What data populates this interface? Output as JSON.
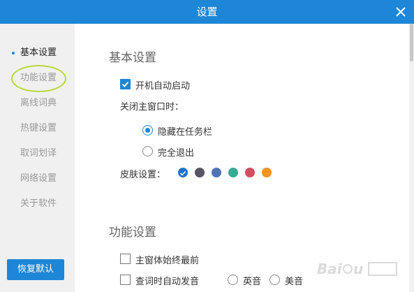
{
  "window": {
    "title": "设置"
  },
  "sidebar": {
    "items": [
      {
        "label": "基本设置",
        "active": true
      },
      {
        "label": "功能设置",
        "active": false
      },
      {
        "label": "离线词典",
        "active": false
      },
      {
        "label": "热键设置",
        "active": false
      },
      {
        "label": "取词划译",
        "active": false
      },
      {
        "label": "网络设置",
        "active": false
      },
      {
        "label": "关于软件",
        "active": false
      }
    ],
    "restore_label": "恢复默认"
  },
  "basic": {
    "title": "基本设置",
    "autostart_label": "开机自动启动",
    "autostart_checked": true,
    "close_label": "关闭主窗口时：",
    "hide_label": "隐藏在任务栏",
    "hide_selected": true,
    "exit_label": "完全退出",
    "exit_selected": false,
    "skin_label": "皮肤设置：",
    "skins": [
      "#1e73c8",
      "#555566",
      "#4f73b6",
      "#3aaa95",
      "#d24f5e",
      "#f39322"
    ],
    "skin_selected_index": 0
  },
  "function": {
    "title": "功能设置",
    "ontop_label": "主窗体始终最前",
    "ontop_checked": false,
    "autoplay_label": "查词时自动发音",
    "autoplay_checked": false,
    "uk_label": "英音",
    "us_label": "美音"
  },
  "accent_color": "#1e86d6"
}
